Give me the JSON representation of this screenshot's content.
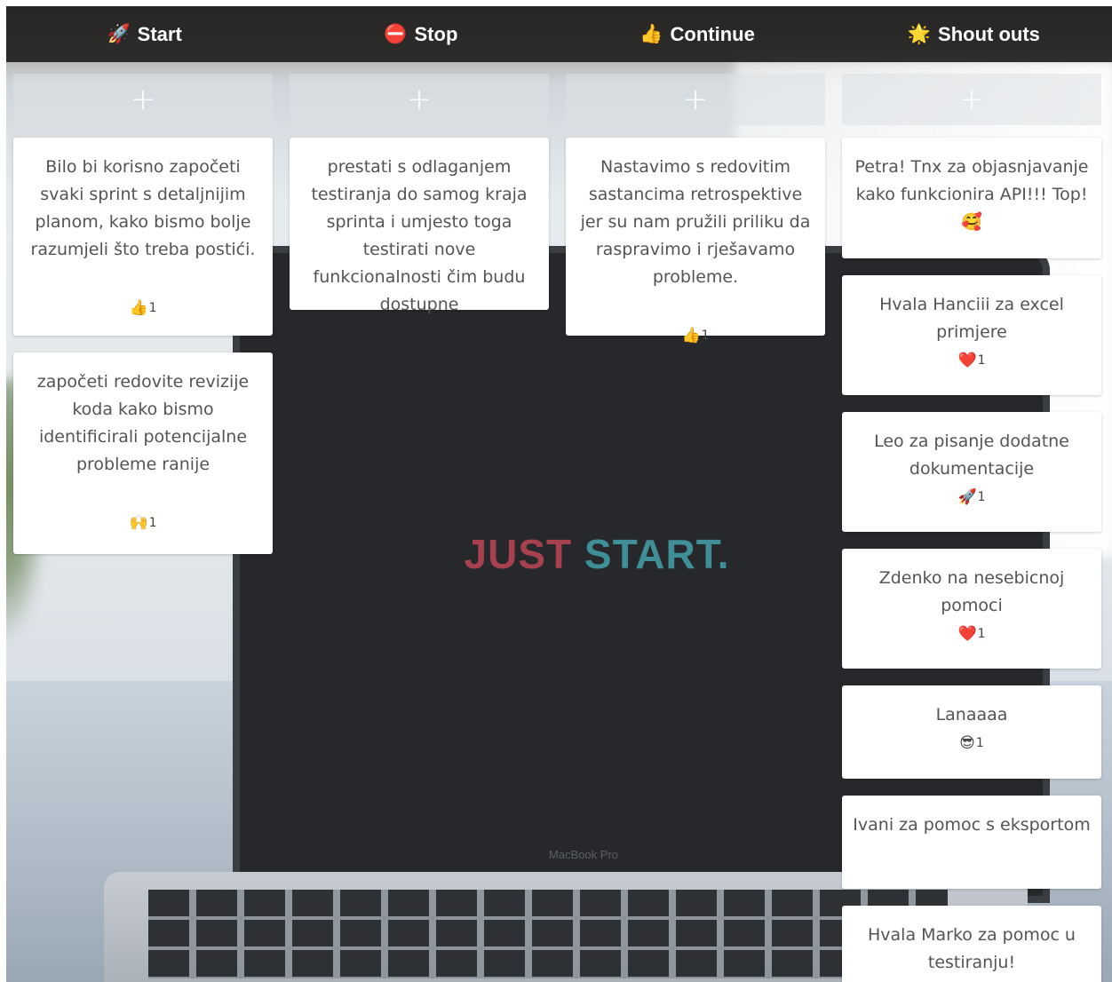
{
  "background": {
    "slogan_word1": "JUST",
    "slogan_word2": "START.",
    "brand": "MacBook Pro"
  },
  "columns": [
    {
      "title": "Start",
      "icon": "🚀",
      "icon_name": "rocket-icon",
      "add_label": "+",
      "cards": [
        {
          "text": "Bilo bi korisno započeti svaki sprint s detaljnijim planom, kako bismo bolje razumjeli što treba postići.",
          "reaction_icon": "👍",
          "reaction_icon_name": "thumbs-up-icon",
          "reaction_count": "1"
        },
        {
          "text": "započeti redovite revizije koda kako bismo identificirali potencijalne probleme ranije",
          "reaction_icon": "🙌",
          "reaction_icon_name": "raised-hands-icon",
          "reaction_count": "1"
        }
      ]
    },
    {
      "title": "Stop",
      "icon": "⛔",
      "icon_name": "no-entry-icon",
      "add_label": "+",
      "cards": [
        {
          "text": "prestati s odlaganjem testiranja do samog kraja sprinta i umjesto toga testirati nove funkcionalnosti čim budu dostupne"
        }
      ]
    },
    {
      "title": "Continue",
      "icon": "👍",
      "icon_name": "thumbs-up-icon",
      "add_label": "+",
      "cards": [
        {
          "text": "Nastavimo s redovitim sastancima retrospektive jer su nam pružili priliku da raspravimo i rješavamo probleme.",
          "reaction_icon": "👍",
          "reaction_icon_name": "thumbs-up-icon",
          "reaction_count": "1"
        }
      ]
    },
    {
      "title": "Shout outs",
      "icon": "🌟",
      "icon_name": "star-icon",
      "add_label": "+",
      "cards": [
        {
          "text": "Petra! Tnx za objasnjavanje kako funkcionira API!!! Top!🥰"
        },
        {
          "text": "Hvala Hanciii za excel primjere",
          "reaction_icon": "❤️",
          "reaction_icon_name": "heart-icon",
          "reaction_count": "1"
        },
        {
          "text": "Leo za pisanje dodatne dokumentacije",
          "reaction_icon": "🚀",
          "reaction_icon_name": "rocket-icon",
          "reaction_count": "1"
        },
        {
          "text": "Zdenko na nesebicnoj pomoci",
          "reaction_icon": "❤️",
          "reaction_icon_name": "heart-icon",
          "reaction_count": "1"
        },
        {
          "text": "Lanaaaa",
          "reaction_icon": "😎",
          "reaction_icon_name": "sunglasses-face-icon",
          "reaction_count": "1"
        },
        {
          "text": "Ivani za pomoc s eksportom"
        },
        {
          "text": "Hvala Marko za pomoc u testiranju!"
        }
      ]
    }
  ]
}
